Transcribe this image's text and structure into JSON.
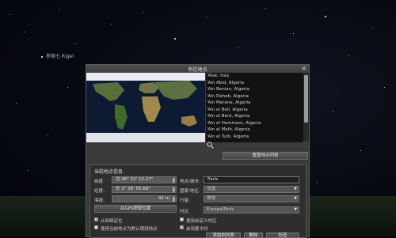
{
  "sky": {
    "star_label": "参宿七 Rigel"
  },
  "dialog": {
    "title": "所在地点",
    "close_glyph": "×",
    "locations": [
      "'Afak, Iraq",
      "'Ain Abid, Algeria",
      "'Ain Benian, Algeria",
      "'Ain Deheb, Algeria",
      "'Ain Merane, Algeria",
      "'Ain el Bell, Algeria",
      "'Ain el Berd, Algeria",
      "'Ain el Hammam, Algeria",
      "'Ain el Melh, Algeria",
      "'Ain el Turk, Algeria"
    ],
    "reset_list_button": "重置地点列表",
    "section_title": "当前地点信息",
    "latitude_label": "纬度:",
    "latitude_value": "北 48° 51' 12.27\"",
    "longitude_label": "经度:",
    "longitude_value": "东 2° 20' 55.68\"",
    "altitude_label": "海拔:",
    "altitude_value": "42 m",
    "gps_button": "从GPS获取位置",
    "name_label": "地点/城市:",
    "name_value": "Paris",
    "country_label": "国家/地区:",
    "country_value": "法国",
    "planet_label": "行星:",
    "planet_value": "地球",
    "timezone_label": "时区:",
    "timezone_value": "Europe/Paris",
    "use_network_label": "从网络定位",
    "use_network_checked": true,
    "use_default_label": "使用当前地点为默认观测地点",
    "use_default_checked": false,
    "custom_tz_label": "使用自定义时区",
    "custom_tz_checked": false,
    "dst_label": "启用夏令时",
    "dst_checked": true,
    "bottom_buttons": [
      "添加到列表",
      "删除",
      "检查"
    ]
  }
}
